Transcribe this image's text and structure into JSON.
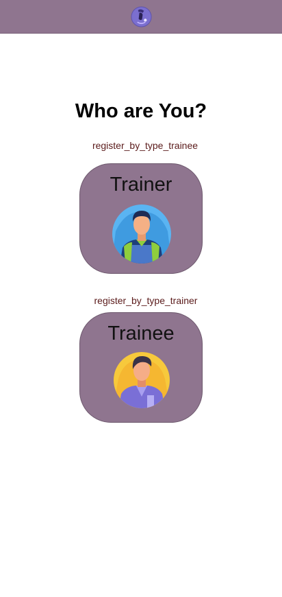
{
  "header": {
    "logo_icon": "app-logo-icon",
    "background": "#8f758f"
  },
  "page": {
    "title": "Who are You?"
  },
  "options": [
    {
      "caption": "register_by_type_trainee",
      "label": "Trainer",
      "icon": "trainer-avatar-icon"
    },
    {
      "caption": "register_by_type_trainer",
      "label": "Trainee",
      "icon": "trainee-avatar-icon"
    }
  ],
  "colors": {
    "accent": "#8f758f",
    "caption_text": "#5a1a1a"
  }
}
